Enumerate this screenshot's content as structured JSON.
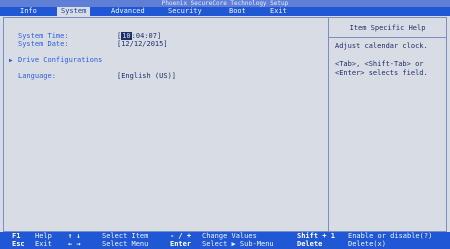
{
  "title": "Phoenix SecureCore Technology Setup",
  "menu": [
    {
      "label": "Info",
      "active": false
    },
    {
      "label": "System",
      "active": true
    },
    {
      "label": "Advanced",
      "active": false
    },
    {
      "label": "Security",
      "active": false
    },
    {
      "label": "Boot",
      "active": false
    },
    {
      "label": "Exit",
      "active": false
    }
  ],
  "fields": {
    "system_time": {
      "label": "System Time:",
      "bracket_open": "[",
      "cursor": "10",
      "rest": ":04:07]"
    },
    "system_date": {
      "label": "System Date:",
      "value": "[12/12/2015]"
    },
    "drive_config": {
      "label": "Drive Configurations",
      "arrow": "▶"
    },
    "language": {
      "label": "Language:",
      "value": "[English (US)]"
    }
  },
  "help": {
    "header": "Item Specific Help",
    "lines": "Adjust calendar clock.\n\n<Tab>, <Shift-Tab> or\n<Enter> selects field."
  },
  "footer": [
    {
      "key": "F1",
      "text": "Help"
    },
    {
      "key": "Esc",
      "text": "Exit"
    },
    {
      "key": "↑ ↓",
      "text": "Select Item"
    },
    {
      "key": "← →",
      "text": "Select Menu"
    },
    {
      "key": "- / +",
      "text": "Change Values"
    },
    {
      "key": "Enter",
      "text": "Select ▶ Sub-Menu"
    },
    {
      "key": "Shift + 1",
      "text": "Enable or disable(?)"
    },
    {
      "key": "Delete",
      "text": "Delete(x)"
    }
  ]
}
